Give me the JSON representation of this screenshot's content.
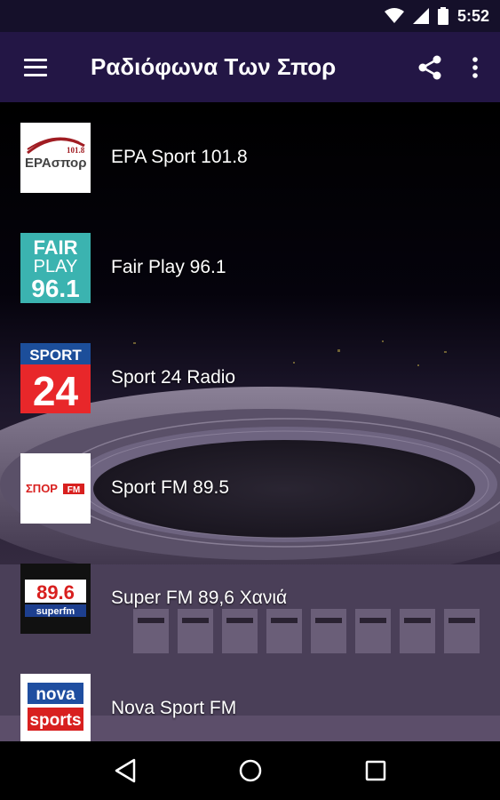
{
  "status_bar": {
    "time": "5:52",
    "icons": [
      "wifi-icon",
      "signal-icon",
      "battery-icon"
    ]
  },
  "app_bar": {
    "title": "Ραδιόφωνα Των Σπορ",
    "menu_icon": "hamburger-menu-icon",
    "share_icon": "share-icon",
    "more_icon": "more-vert-icon",
    "color": "#231645"
  },
  "stations": [
    {
      "name": "EPA Sport 101.8",
      "logo": {
        "top": "101.8",
        "main": "ΕΡΑσπορ"
      }
    },
    {
      "name": "Fair Play 96.1",
      "logo": {
        "line1": "FAIR",
        "line2": "PLAY",
        "line3": "96.1"
      }
    },
    {
      "name": "Sport 24 Radio",
      "logo": {
        "line1": "SPORT",
        "line2": "24"
      }
    },
    {
      "name": "Sport FM 89.5",
      "logo": {
        "main": "ΣΠΟΡ",
        "sub": "FM"
      }
    },
    {
      "name": "Super FM 89,6 Χανιά",
      "logo": {
        "freq": "89.6",
        "brand": "superfm"
      }
    },
    {
      "name": "Nova Sport FM",
      "logo": {
        "line1": "nova",
        "line2": "sports"
      }
    }
  ],
  "nav_bar": {
    "back_icon": "back-triangle-icon",
    "home_icon": "home-circle-icon",
    "recents_icon": "recents-square-icon"
  }
}
